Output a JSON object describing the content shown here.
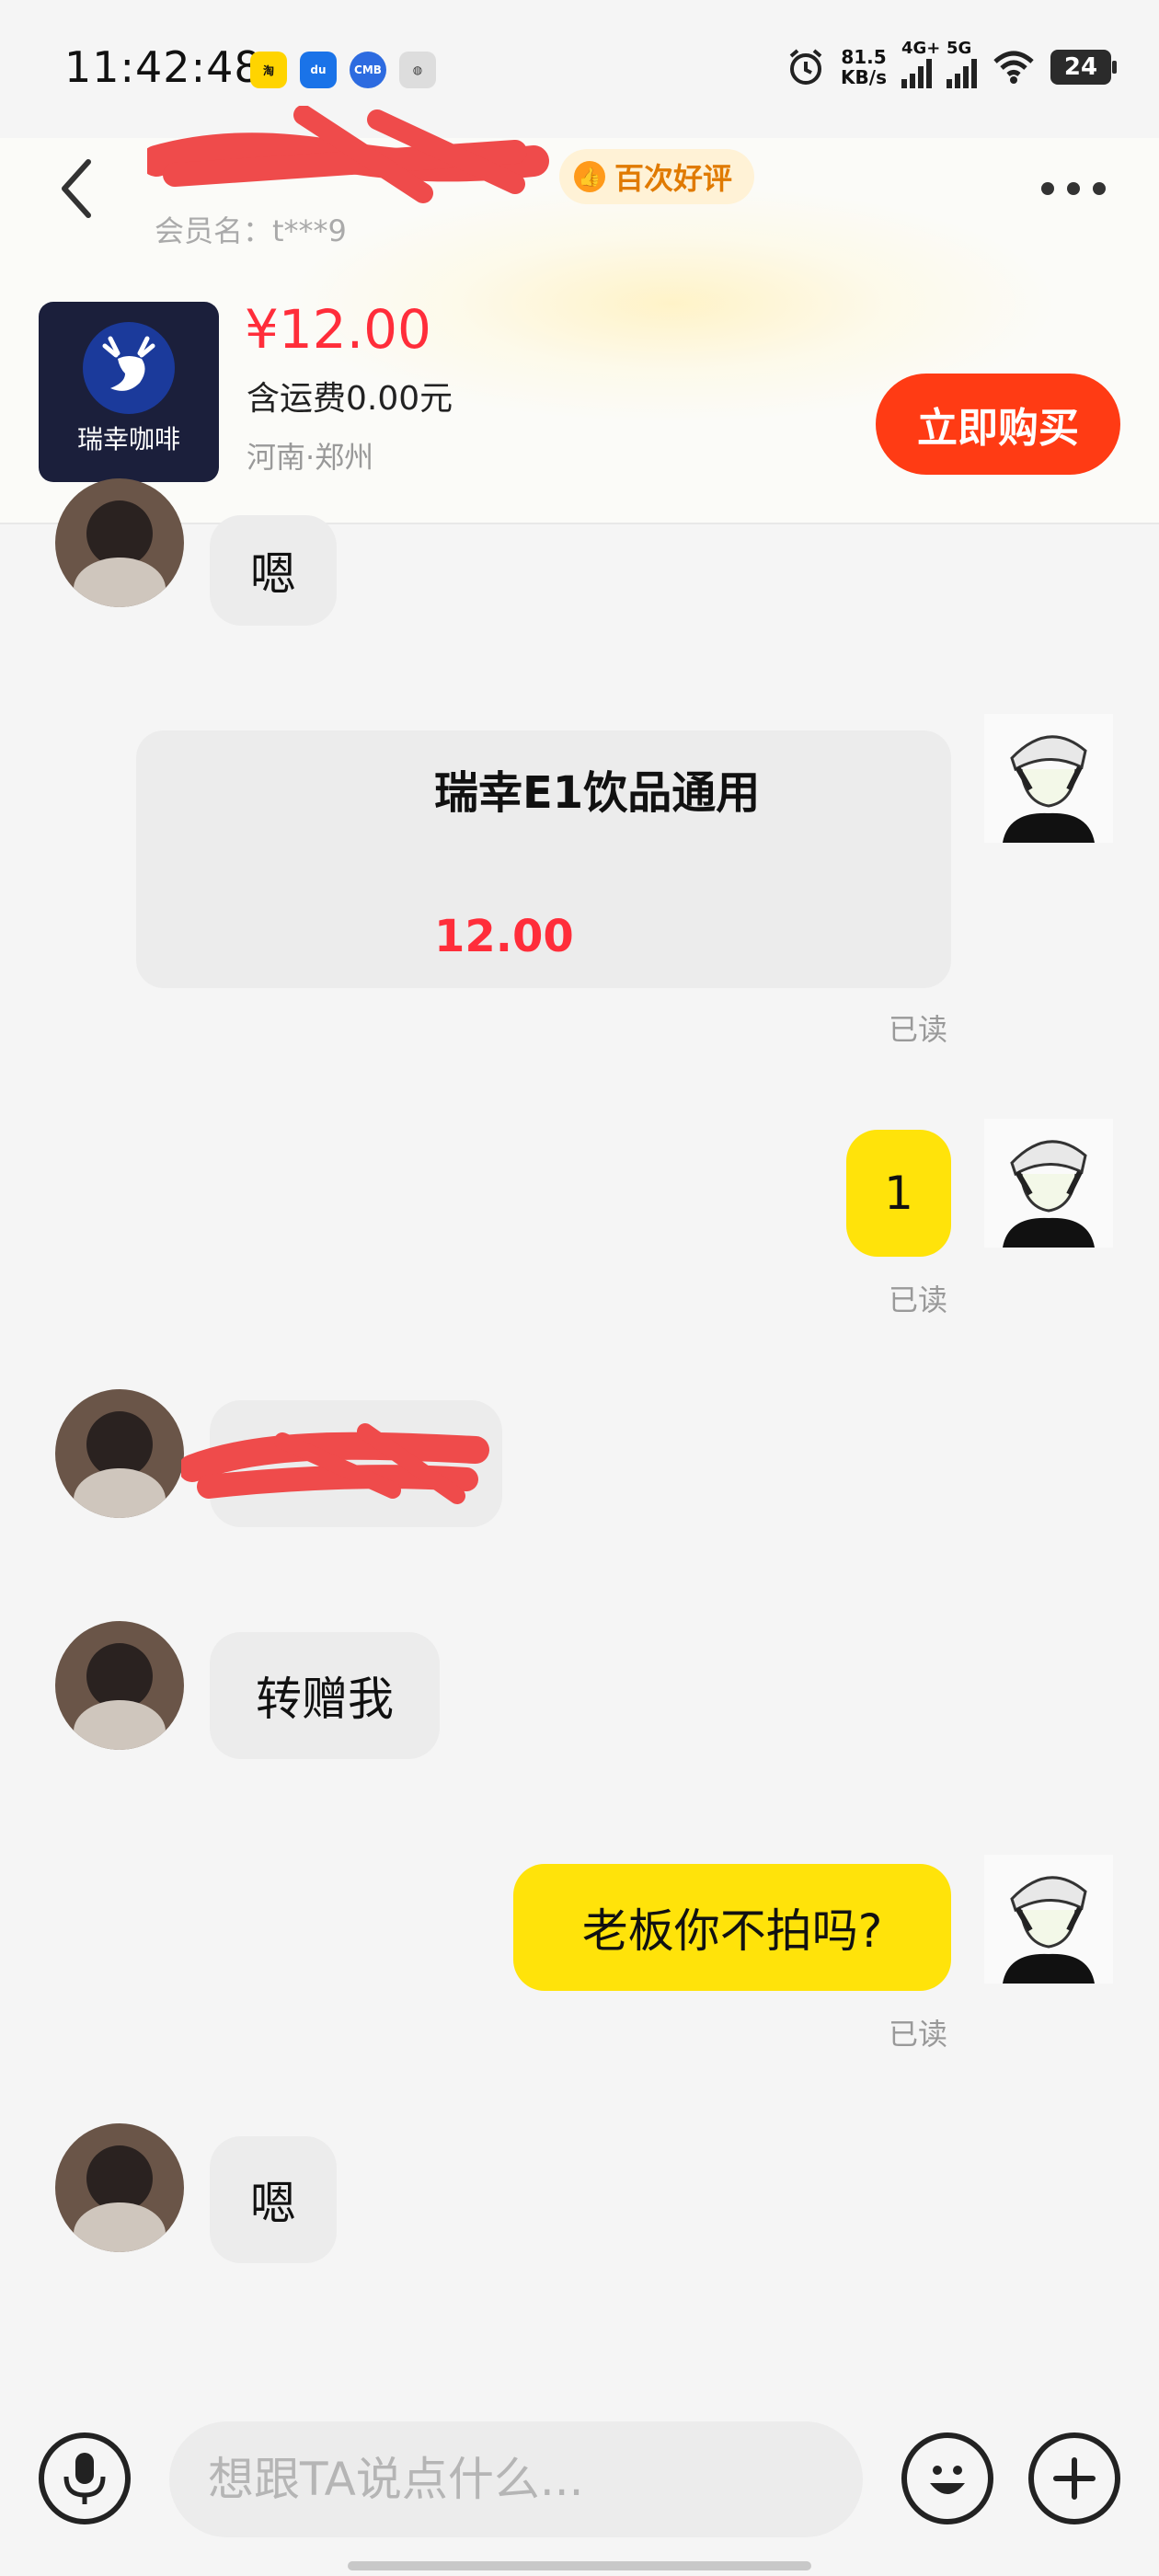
{
  "status_bar": {
    "time": "11:42:48",
    "app_icons": [
      "taobao-icon",
      "du-icon",
      "cmb-icon",
      "notify-icon"
    ],
    "net_speed_value": "81.5",
    "net_speed_unit": "KB/s",
    "signal1_label": "4G+",
    "signal2_label": "5G",
    "battery": "24"
  },
  "header": {
    "back_icon": "chevron-left-icon",
    "badge_label": "百次好评",
    "member_label": "会员名：t***9",
    "more_icon": "more-dots-icon"
  },
  "product": {
    "brand": "瑞幸咖啡",
    "price": "¥12.00",
    "shipping": "含运费0.00元",
    "location": "河南·郑州",
    "buy_label": "立即购买"
  },
  "messages": {
    "m1": "嗯",
    "card_title": "瑞幸E1饮品通用",
    "card_price": "12.00",
    "read1": "已读",
    "m3": "1",
    "read2": "已读",
    "m5": "转赠我",
    "m6": "老板你不拍吗?",
    "read3": "已读",
    "m7": "嗯"
  },
  "bottom_bar": {
    "placeholder": "想跟TA说点什么...",
    "voice_icon": "microphone-icon",
    "emoji_icon": "emoji-icon",
    "plus_icon": "plus-icon"
  },
  "colors": {
    "accent_yellow": "#ffe30a",
    "price_red": "#ff2d3a",
    "buy_orange": "#ff3b14",
    "redaction": "#ef4b4b"
  }
}
